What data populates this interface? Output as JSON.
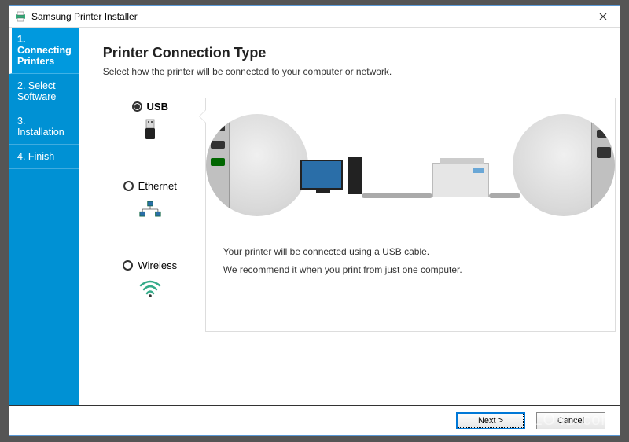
{
  "window": {
    "title": "Samsung Printer Installer"
  },
  "sidebar": {
    "items": [
      {
        "label": "1. Connecting Printers",
        "active": true
      },
      {
        "label": "2. Select Software",
        "active": false
      },
      {
        "label": "3. Installation",
        "active": false
      },
      {
        "label": "4. Finish",
        "active": false
      }
    ]
  },
  "main": {
    "heading": "Printer Connection Type",
    "subtitle": "Select how the printer will be connected to your computer or network.",
    "options": [
      {
        "id": "usb",
        "label": "USB",
        "checked": true
      },
      {
        "id": "ethernet",
        "label": "Ethernet",
        "checked": false
      },
      {
        "id": "wireless",
        "label": "Wireless",
        "checked": false
      }
    ],
    "panel": {
      "line1": "Your printer will be connected using a USB cable.",
      "line2": "We recommend it when you print from just one computer."
    }
  },
  "footer": {
    "next_label": "Next >",
    "cancel_label": "Cancel"
  },
  "watermark": "LO4D.com"
}
